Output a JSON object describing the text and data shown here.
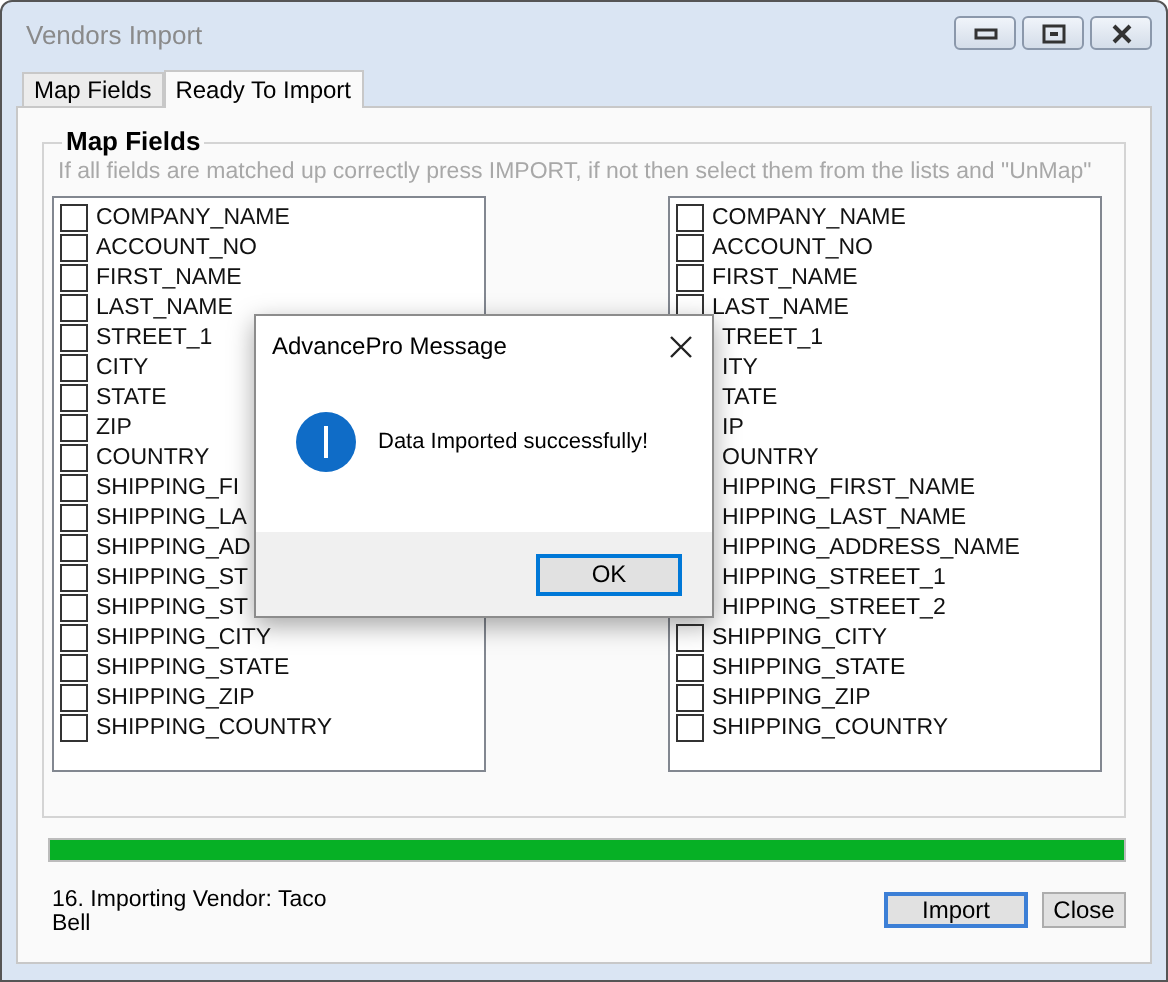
{
  "window": {
    "title": "Vendors Import"
  },
  "tabs": [
    {
      "label": "Map Fields",
      "selected": false
    },
    {
      "label": "Ready To Import",
      "selected": true
    }
  ],
  "group": {
    "title": "Map Fields",
    "hint": "If all fields are matched up correctly press IMPORT, if not then select them from the lists and  \"UnMap\""
  },
  "left_list": [
    {
      "label": "COMPANY_NAME",
      "checked": false
    },
    {
      "label": "ACCOUNT_NO",
      "checked": false
    },
    {
      "label": "FIRST_NAME",
      "checked": false
    },
    {
      "label": "LAST_NAME",
      "checked": false
    },
    {
      "label": "STREET_1",
      "checked": false
    },
    {
      "label": "CITY",
      "checked": false
    },
    {
      "label": "STATE",
      "checked": false
    },
    {
      "label": "ZIP",
      "checked": false
    },
    {
      "label": "COUNTRY",
      "checked": false
    },
    {
      "label": "SHIPPING_FI",
      "checked": false
    },
    {
      "label": "SHIPPING_LA",
      "checked": false
    },
    {
      "label": "SHIPPING_AD",
      "checked": false
    },
    {
      "label": "SHIPPING_ST",
      "checked": false
    },
    {
      "label": "SHIPPING_ST",
      "checked": false
    },
    {
      "label": "SHIPPING_CITY",
      "checked": false
    },
    {
      "label": "SHIPPING_STATE",
      "checked": false
    },
    {
      "label": "SHIPPING_ZIP",
      "checked": false
    },
    {
      "label": "SHIPPING_COUNTRY",
      "checked": false
    }
  ],
  "right_list": [
    {
      "kind": "item",
      "label": "COMPANY_NAME",
      "checked": false
    },
    {
      "kind": "item",
      "label": "ACCOUNT_NO",
      "checked": false
    },
    {
      "kind": "item",
      "label": "FIRST_NAME",
      "checked": false
    },
    {
      "kind": "item",
      "label": "LAST_NAME",
      "checked": false
    },
    {
      "kind": "clipped",
      "label": "TREET_1"
    },
    {
      "kind": "clipped",
      "label": "ITY"
    },
    {
      "kind": "clipped",
      "label": "TATE"
    },
    {
      "kind": "clipped",
      "label": "IP"
    },
    {
      "kind": "clipped",
      "label": "OUNTRY"
    },
    {
      "kind": "clipped",
      "label": "HIPPING_FIRST_NAME"
    },
    {
      "kind": "clipped",
      "label": "HIPPING_LAST_NAME"
    },
    {
      "kind": "clipped",
      "label": "HIPPING_ADDRESS_NAME"
    },
    {
      "kind": "clipped",
      "label": "HIPPING_STREET_1"
    },
    {
      "kind": "clipped",
      "label": "HIPPING_STREET_2"
    },
    {
      "kind": "item",
      "label": "SHIPPING_CITY",
      "checked": false
    },
    {
      "kind": "item",
      "label": "SHIPPING_STATE",
      "checked": false
    },
    {
      "kind": "item",
      "label": "SHIPPING_ZIP",
      "checked": false
    },
    {
      "kind": "item",
      "label": "SHIPPING_COUNTRY",
      "checked": false
    }
  ],
  "progress": {
    "level": 1
  },
  "status": "16. Importing Vendor: Taco Bell",
  "buttons": [
    {
      "label": "Import",
      "default": true
    },
    {
      "label": "Close",
      "default": false
    }
  ],
  "dialog": {
    "title": "AdvancePro Message",
    "message": "Data Imported successfully!",
    "button": "OK"
  }
}
